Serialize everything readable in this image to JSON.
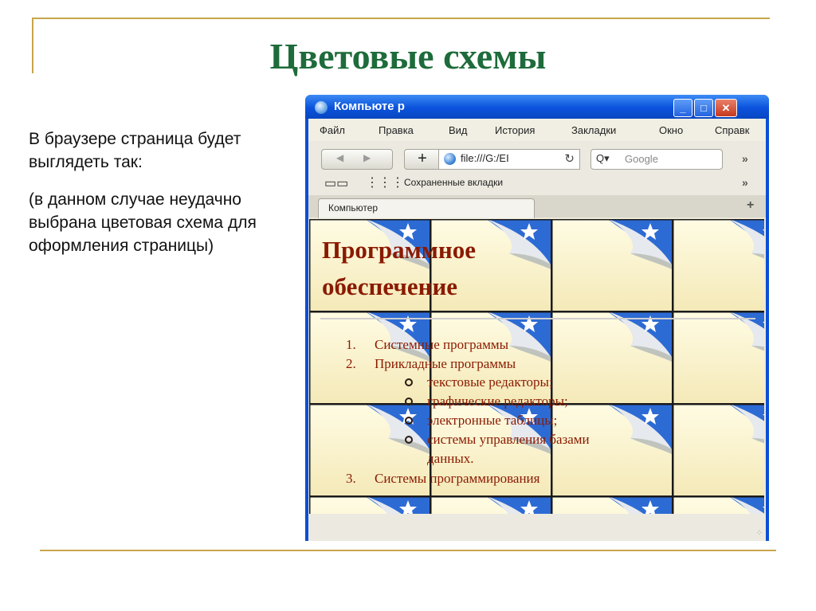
{
  "slide": {
    "title": "Цветовые схемы",
    "paragraph1": "В браузере страница будет выглядеть так:",
    "paragraph2": "(в данном случае неудачно выбрана цветовая схема для оформления страницы)"
  },
  "colors": {
    "title": "#1e6b3b",
    "rule": "#c8a54a",
    "page_text": "#8a1a00",
    "tile_blue": "#2d6bd4",
    "tile_cream": "#fffad6",
    "window_frame": "#0a4fd6"
  },
  "browser": {
    "window_title": "Компьюте р",
    "menu": [
      "Файл",
      "Правка",
      "Вид",
      "История",
      "Закладки",
      "Окно",
      "Справк"
    ],
    "url": "file:///G:/EI",
    "search_placeholder": "Google",
    "bookmarks_label": "Сохраненные вкладки",
    "tab_label": "Компьютер",
    "icons": [
      "back-icon",
      "forward-icon",
      "plus-icon",
      "globe-icon",
      "reload-icon",
      "search-icon",
      "book-icon",
      "grid-icon",
      "chevron-icon"
    ]
  },
  "page": {
    "heading_line1": "Программное",
    "heading_line2": "обеспечение",
    "list": [
      {
        "n": "1.",
        "text": "Системные программы"
      },
      {
        "n": "2.",
        "text": "Прикладные программы"
      },
      {
        "n": "3.",
        "text": "Системы программирования"
      }
    ],
    "sublist": [
      "текстовые редакторы;",
      "графические редакторы;",
      "электронные таблицы;",
      "системы управления базами",
      "данных."
    ]
  }
}
